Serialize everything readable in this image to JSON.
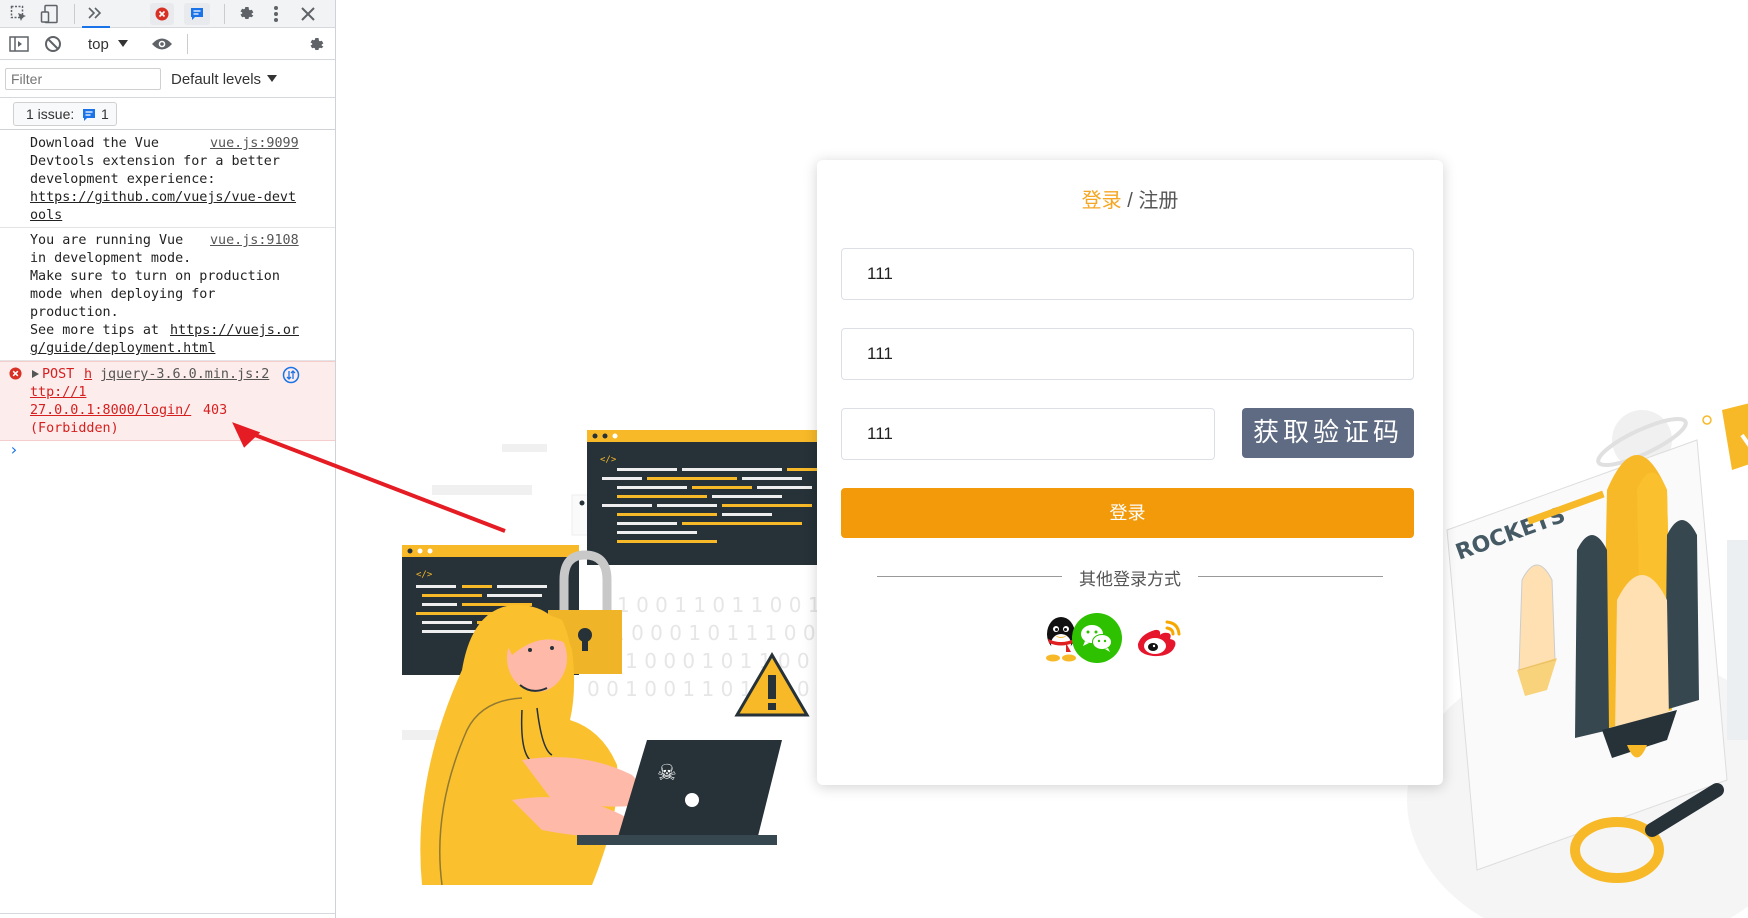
{
  "devtools": {
    "context_selector": "top",
    "filter_placeholder": "Filter",
    "levels_label": "Default levels",
    "issues_label": "1 issue:",
    "issues_count": "1",
    "logs": [
      {
        "lines": [
          "Download the Vue",
          "Devtools extension for a better",
          "development experience:"
        ],
        "link_lines": [
          "https://github.com/vuejs/vue-devt",
          "ools"
        ],
        "source": "vue.js:9099"
      },
      {
        "lines": [
          "You are running Vue",
          "in development mode.",
          "Make sure to turn on production",
          "mode when deploying for",
          "production.",
          "See more tips at "
        ],
        "link_inline": "https://vuejs.or",
        "link_lines": [
          "g/guide/deployment.html"
        ],
        "source": "vue.js:9108"
      },
      {
        "method": "POST",
        "url_parts": [
          "h",
          "ttp://1",
          "27.0.0.1:8000/login/"
        ],
        "status": "403",
        "status_text": "(Forbidden)",
        "source": "jquery-3.6.0.min.js:2",
        "level": "error"
      }
    ],
    "prompt": "›"
  },
  "login_card": {
    "title_login": "登录",
    "title_sep": " / ",
    "title_register": "注册",
    "field1_value": "111",
    "field2_value": "111",
    "field3_value": "111",
    "get_code_label": "获取验证码",
    "login_button": "登录",
    "other_methods": "其他登录方式",
    "social": [
      "qq-icon",
      "wechat-icon",
      "weibo-icon"
    ]
  },
  "illustration": {
    "rockets_text": "ROCKETS",
    "binary_rows": [
      "1 0 0 1 1 0 1 1 0 0 1 1 1",
      "1 0 0 0 1 0 1 1 1 0 0 0",
      "1 0 1 0 0 0 1 0 1 1 0 0 1",
      "0 0 1 0 0 1 1 0 1 1 1 0"
    ]
  },
  "colors": {
    "accent": "#f29a0a",
    "code_button": "#5e6b82",
    "error_bg": "#fdecec",
    "error_text": "#d61f1f",
    "yellow": "#f7b928"
  }
}
